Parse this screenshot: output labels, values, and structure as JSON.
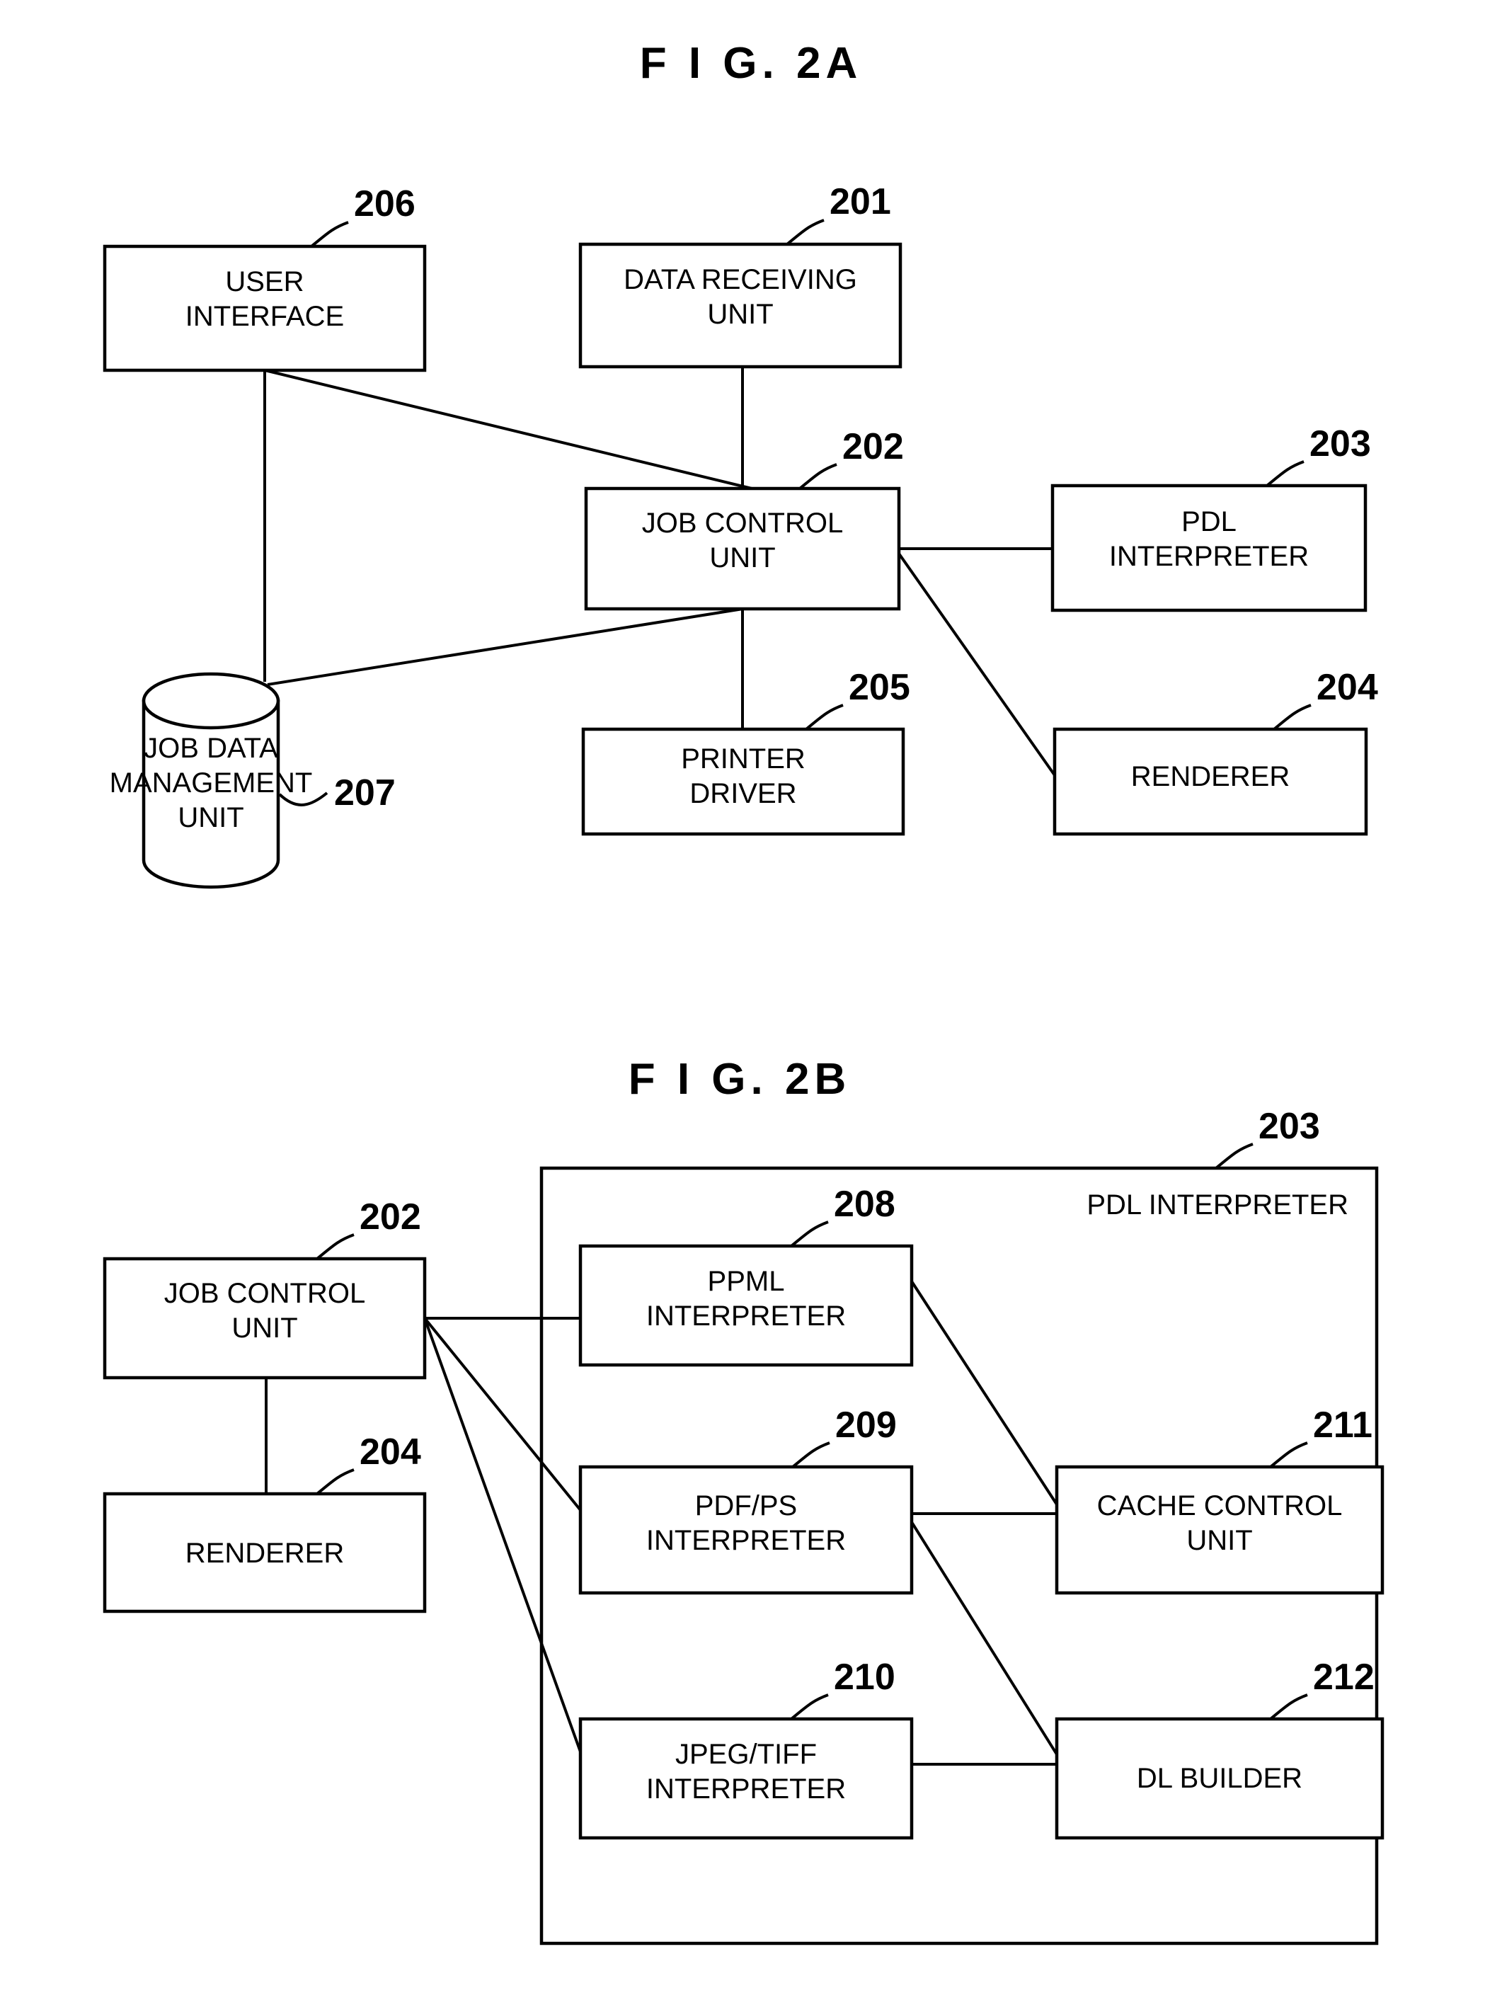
{
  "figures": [
    {
      "id": "fig-2a",
      "title": "F I G.  2A",
      "blocks": [
        {
          "key": "user_interface",
          "ref": "206",
          "lines": [
            "USER",
            "INTERFACE"
          ]
        },
        {
          "key": "data_receiving_unit",
          "ref": "201",
          "lines": [
            "DATA RECEIVING",
            "UNIT"
          ]
        },
        {
          "key": "job_control_unit",
          "ref": "202",
          "lines": [
            "JOB CONTROL",
            "UNIT"
          ]
        },
        {
          "key": "pdl_interpreter",
          "ref": "203",
          "lines": [
            "PDL",
            "INTERPRETER"
          ]
        },
        {
          "key": "renderer",
          "ref": "204",
          "lines": [
            "RENDERER"
          ]
        },
        {
          "key": "printer_driver",
          "ref": "205",
          "lines": [
            "PRINTER",
            "DRIVER"
          ]
        },
        {
          "key": "job_data_mgmt_unit",
          "ref": "207",
          "lines": [
            "JOB DATA",
            "MANAGEMENT",
            "UNIT"
          ]
        }
      ]
    },
    {
      "id": "fig-2b",
      "title": "F I G.  2B",
      "container": {
        "key": "pdl_interpreter_container",
        "ref": "203",
        "label": "PDL INTERPRETER"
      },
      "blocks": [
        {
          "key": "job_control_unit",
          "ref": "202",
          "lines": [
            "JOB CONTROL",
            "UNIT"
          ]
        },
        {
          "key": "renderer",
          "ref": "204",
          "lines": [
            "RENDERER"
          ]
        },
        {
          "key": "ppml_interpreter",
          "ref": "208",
          "lines": [
            "PPML",
            "INTERPRETER"
          ]
        },
        {
          "key": "pdfps_interpreter",
          "ref": "209",
          "lines": [
            "PDF/PS",
            "INTERPRETER"
          ]
        },
        {
          "key": "jpegtiff_interpreter",
          "ref": "210",
          "lines": [
            "JPEG/TIFF",
            "INTERPRETER"
          ]
        },
        {
          "key": "cache_control_unit",
          "ref": "211",
          "lines": [
            "CACHE CONTROL",
            "UNIT"
          ]
        },
        {
          "key": "dl_builder",
          "ref": "212",
          "lines": [
            "DL BUILDER"
          ]
        }
      ]
    }
  ],
  "fig2a": {
    "title": "F I G.  2A",
    "user_interface": {
      "ref": "206",
      "line1": "USER",
      "line2": "INTERFACE"
    },
    "data_receiving_unit": {
      "ref": "201",
      "line1": "DATA RECEIVING",
      "line2": "UNIT"
    },
    "job_control_unit": {
      "ref": "202",
      "line1": "JOB CONTROL",
      "line2": "UNIT"
    },
    "pdl_interpreter": {
      "ref": "203",
      "line1": "PDL",
      "line2": "INTERPRETER"
    },
    "renderer": {
      "ref": "204",
      "line1": "RENDERER"
    },
    "printer_driver": {
      "ref": "205",
      "line1": "PRINTER",
      "line2": "DRIVER"
    },
    "job_data_management_unit": {
      "ref": "207",
      "line1": "JOB DATA",
      "line2": "MANAGEMENT",
      "line3": "UNIT"
    }
  },
  "fig2b": {
    "title": "F I G.  2B",
    "pdl_interpreter_container": {
      "ref": "203",
      "label": "PDL INTERPRETER"
    },
    "job_control_unit": {
      "ref": "202",
      "line1": "JOB CONTROL",
      "line2": "UNIT"
    },
    "renderer": {
      "ref": "204",
      "line1": "RENDERER"
    },
    "ppml_interpreter": {
      "ref": "208",
      "line1": "PPML",
      "line2": "INTERPRETER"
    },
    "pdfps_interpreter": {
      "ref": "209",
      "line1": "PDF/PS",
      "line2": "INTERPRETER"
    },
    "jpegtiff_interpreter": {
      "ref": "210",
      "line1": "JPEG/TIFF",
      "line2": "INTERPRETER"
    },
    "cache_control_unit": {
      "ref": "211",
      "line1": "CACHE CONTROL",
      "line2": "UNIT"
    },
    "dl_builder": {
      "ref": "212",
      "line1": "DL BUILDER"
    }
  },
  "colors": {
    "ink": "#000000",
    "paper": "#ffffff"
  }
}
